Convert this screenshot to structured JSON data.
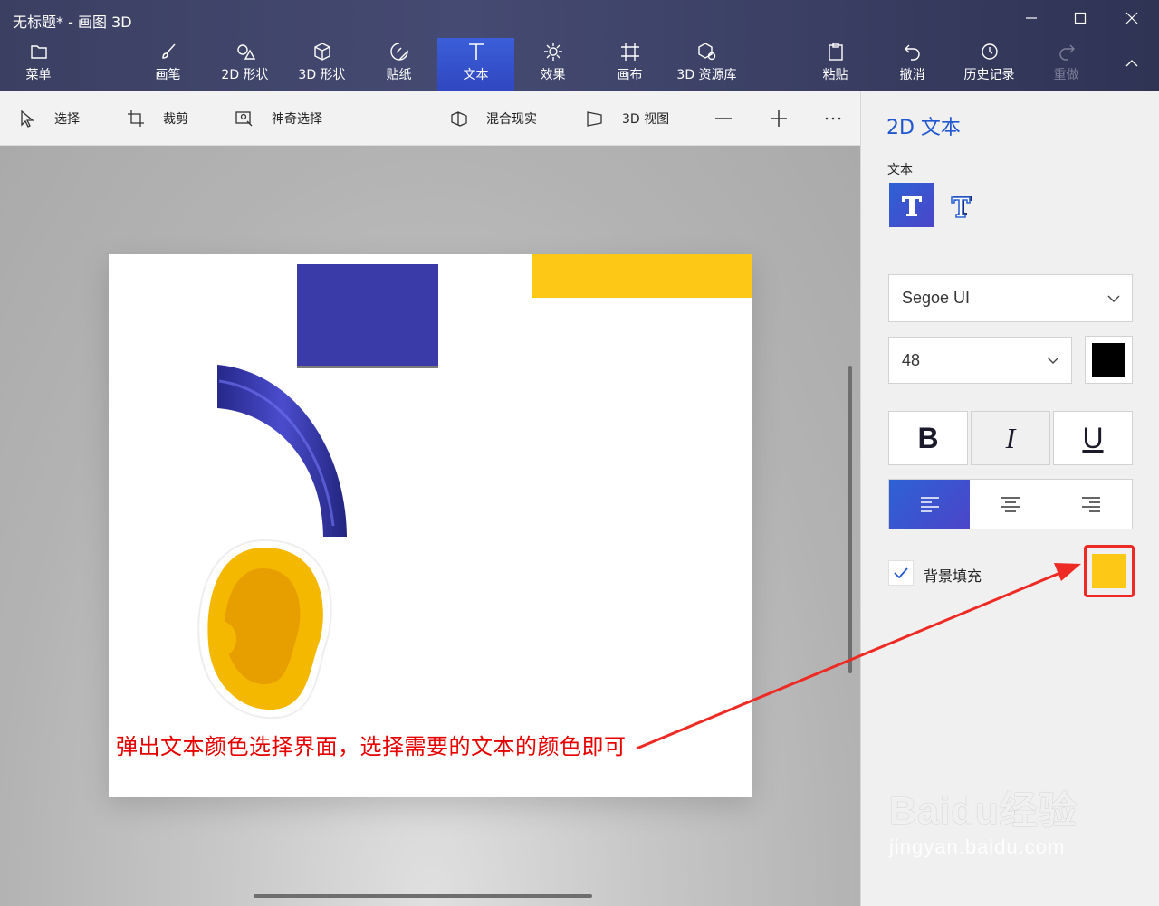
{
  "window": {
    "title": "无标题* - 画图 3D"
  },
  "ribbon": {
    "items": [
      {
        "label": "菜单",
        "icon": "folder-icon"
      },
      {
        "label": "画笔",
        "icon": "brush-icon"
      },
      {
        "label": "2D 形状",
        "icon": "2d-shapes-icon"
      },
      {
        "label": "3D 形状",
        "icon": "3d-shapes-icon"
      },
      {
        "label": "贴纸",
        "icon": "sticker-icon"
      },
      {
        "label": "文本",
        "icon": "text-icon",
        "active": true
      },
      {
        "label": "效果",
        "icon": "effects-icon"
      },
      {
        "label": "画布",
        "icon": "canvas-icon"
      },
      {
        "label": "3D 资源库",
        "icon": "3d-library-icon"
      },
      {
        "label": "粘贴",
        "icon": "paste-icon"
      },
      {
        "label": "撤消",
        "icon": "undo-icon"
      },
      {
        "label": "历史记录",
        "icon": "history-icon"
      },
      {
        "label": "重做",
        "icon": "redo-icon",
        "disabled": true
      }
    ]
  },
  "toolstrip": {
    "select": "选择",
    "crop": "裁剪",
    "magic_select": "神奇选择",
    "mixed_reality": "混合现实",
    "view_3d": "3D 视图"
  },
  "canvas": {
    "annotation": "弹出文本颜色选择界面，选择需要的文本的颜色即可",
    "shape_colors": {
      "blue": "#3a3ba8",
      "yellow": "#fdc816",
      "ear": "#f5b800"
    }
  },
  "panel": {
    "title": "2D 文本",
    "text_section": "文本",
    "font": "Segoe UI",
    "size": "48",
    "text_color": "#000000",
    "bold": "B",
    "italic": "I",
    "underline": "U",
    "background_fill_label": "背景填充",
    "background_fill_color": "#fdc816"
  },
  "watermark": {
    "main": "Baidu经验",
    "sub": "jingyan.baidu.com"
  }
}
